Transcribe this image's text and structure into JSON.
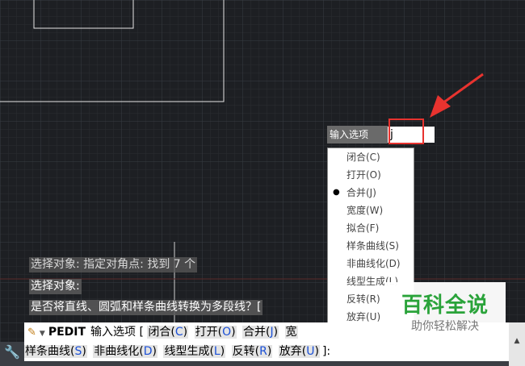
{
  "prompt": {
    "label": "输入选项",
    "value": "j"
  },
  "option_menu": {
    "items": [
      {
        "label": "闭合(C)",
        "selected": false
      },
      {
        "label": "打开(O)",
        "selected": false
      },
      {
        "label": "合并(J)",
        "selected": true
      },
      {
        "label": "宽度(W)",
        "selected": false
      },
      {
        "label": "拟合(F)",
        "selected": false
      },
      {
        "label": "样条曲线(S)",
        "selected": false
      },
      {
        "label": "非曲线化(D)",
        "selected": false
      },
      {
        "label": "线型生成(L)",
        "selected": false
      },
      {
        "label": "反转(R)",
        "selected": false
      },
      {
        "label": "放弃(U)",
        "selected": false
      }
    ]
  },
  "command_history": [
    "选择对象: 指定对角点: 找到 7 个",
    "选择对象:",
    "是否将直线、圆弧和样条曲线转换为多段线？["
  ],
  "command_line": {
    "command": "PEDIT",
    "prompt": "输入选项 [",
    "options_row1": [
      {
        "name": "闭合",
        "key": "C"
      },
      {
        "name": "打开",
        "key": "O"
      },
      {
        "name": "合并",
        "key": "J"
      },
      {
        "name": "宽",
        "key": ""
      }
    ],
    "options_row2": [
      {
        "name": "样条曲线",
        "key": "S"
      },
      {
        "name": "非曲线化",
        "key": "D"
      },
      {
        "name": "线型生成",
        "key": "L"
      },
      {
        "name": "反转",
        "key": "R"
      },
      {
        "name": "放弃",
        "key": "U"
      }
    ],
    "suffix": "]:"
  },
  "watermark": {
    "title": "百科全说",
    "subtitle": "助你轻松解决"
  },
  "colors": {
    "canvas": "#1d1f23",
    "accent_red": "#e8332f",
    "key_blue": "#1a4fd6",
    "watermark_green": "#2aa33a"
  }
}
